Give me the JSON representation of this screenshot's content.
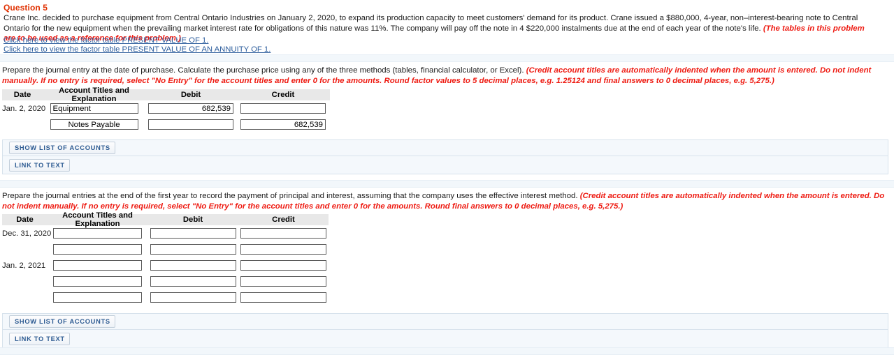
{
  "question": {
    "title": "Question 5",
    "statement_part1": "Crane Inc. decided to purchase equipment from Central Ontario Industries on January 2, 2020, to expand its production capacity to meet customers' demand for its product. Crane issued a $880,000, 4-year, non–interest-bearing note to Central Ontario for the new equipment when the prevailing market interest rate for obligations of this nature was 11%. The company will pay off the note in 4 $220,000 instalments due at the end of each year of the note's life. ",
    "statement_note": "(The tables in this problem are to be used as a reference for this problem.)"
  },
  "links": [
    {
      "label": "Click here to view the factor table PRESENT VALUE OF 1."
    },
    {
      "label": "Click here to view the factor table PRESENT VALUE OF AN ANNUITY OF 1."
    }
  ],
  "part_a": {
    "instruction": "Prepare the journal entry at the date of purchase. Calculate the purchase price using any of the three methods (tables, financial calculator, or Excel). ",
    "instruction_note": "(Credit account titles are automatically indented when the amount is entered. Do not indent manually. If no entry is required, select \"No Entry\" for the account titles and enter 0 for the amounts. Round factor values to 5 decimal places, e.g. 1.25124 and final answers to 0 decimal places, e.g. 5,275.)",
    "table": {
      "headers": [
        "Date",
        "Account Titles and Explanation",
        "Debit",
        "Credit"
      ],
      "rows": [
        {
          "date": "Jan. 2, 2020",
          "account": "Equipment",
          "indented": false,
          "debit": "682,539",
          "credit": ""
        },
        {
          "date": "",
          "account": "Notes Payable",
          "indented": true,
          "debit": "",
          "credit": "682,539"
        }
      ]
    },
    "buttons": {
      "show_list": "SHOW LIST OF ACCOUNTS",
      "link_to_text": "LINK TO TEXT"
    }
  },
  "part_b": {
    "instruction": "Prepare the journal entries at the end of the first year to record the payment of principal and interest, assuming that the company uses the effective interest method. ",
    "instruction_note": "(Credit account titles are automatically indented when the amount is entered. Do not indent manually. If no entry is required, select \"No Entry\" for the account titles and enter 0 for the amounts. Round final answers to 0 decimal places, e.g. 5,275.)",
    "table": {
      "headers": [
        "Date",
        "Account Titles and Explanation",
        "Debit",
        "Credit"
      ],
      "rows": [
        {
          "date": "Dec. 31, 2020",
          "account": "",
          "indented": false,
          "debit": "",
          "credit": ""
        },
        {
          "date": "",
          "account": "",
          "indented": false,
          "debit": "",
          "credit": ""
        },
        {
          "date": "Jan. 2, 2021",
          "account": "",
          "indented": false,
          "debit": "",
          "credit": ""
        },
        {
          "date": "",
          "account": "",
          "indented": false,
          "debit": "",
          "credit": ""
        },
        {
          "date": "",
          "account": "",
          "indented": false,
          "debit": "",
          "credit": ""
        }
      ]
    },
    "buttons": {
      "show_list": "SHOW LIST OF ACCOUNTS",
      "link_to_text": "LINK TO TEXT"
    }
  },
  "colors": {
    "heading_red": "#e03000",
    "note_red": "#ee1b12",
    "link_blue": "#2b5c9c",
    "button_blue": "#2d5b92",
    "panel_bg": "#f4f8fc",
    "table_header_bg": "#e8e8e8"
  }
}
